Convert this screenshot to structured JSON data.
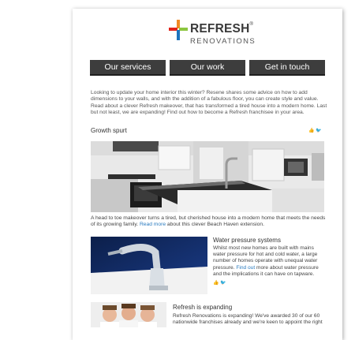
{
  "brand": {
    "name_line1": "REFRESH",
    "name_line2": "RENOVATIONS",
    "reg": "®",
    "colors": {
      "orange": "#f08a24",
      "green": "#8cc63f",
      "red": "#e2231a",
      "blue": "#1e73be"
    }
  },
  "nav": [
    {
      "label": "Our services"
    },
    {
      "label": "Our work"
    },
    {
      "label": "Get in touch"
    }
  ],
  "intro": "Looking to update your home interior this winter? Resene shares some advice on how to add dimensions to your walls, and with the addition of a fabulous floor, you can create style and value. Read about a clever Refresh makeover, that has transformed a tired house into a modern home. Last but not least, we are expanding! Find out how to become a Refresh franchisee in your area.",
  "growth": {
    "title": "Growth spurt",
    "caption_pre": "A head to toe makeover turns a tired, but cherished house into a modern home that meets the needs of its growing family. ",
    "caption_link": "Read more",
    "caption_post": " about this clever Beach Haven extension."
  },
  "water": {
    "title": "Water pressure systems",
    "text_pre": "Whilst most new homes are built with mains water pressure for hot and cold water, a large number of homes operate with unequal water pressure. ",
    "text_link": "Find out",
    "text_post": " more about water pressure and the implications it can have on tapware."
  },
  "expanding": {
    "title": "Refresh is expanding",
    "text": "Refresh Renovations is expanding! We've awarded 30 of our 60 nationwide franchises already and we're keen to appoint the right"
  },
  "icons": {
    "like": "like-icon",
    "tweet": "twitter-icon"
  }
}
